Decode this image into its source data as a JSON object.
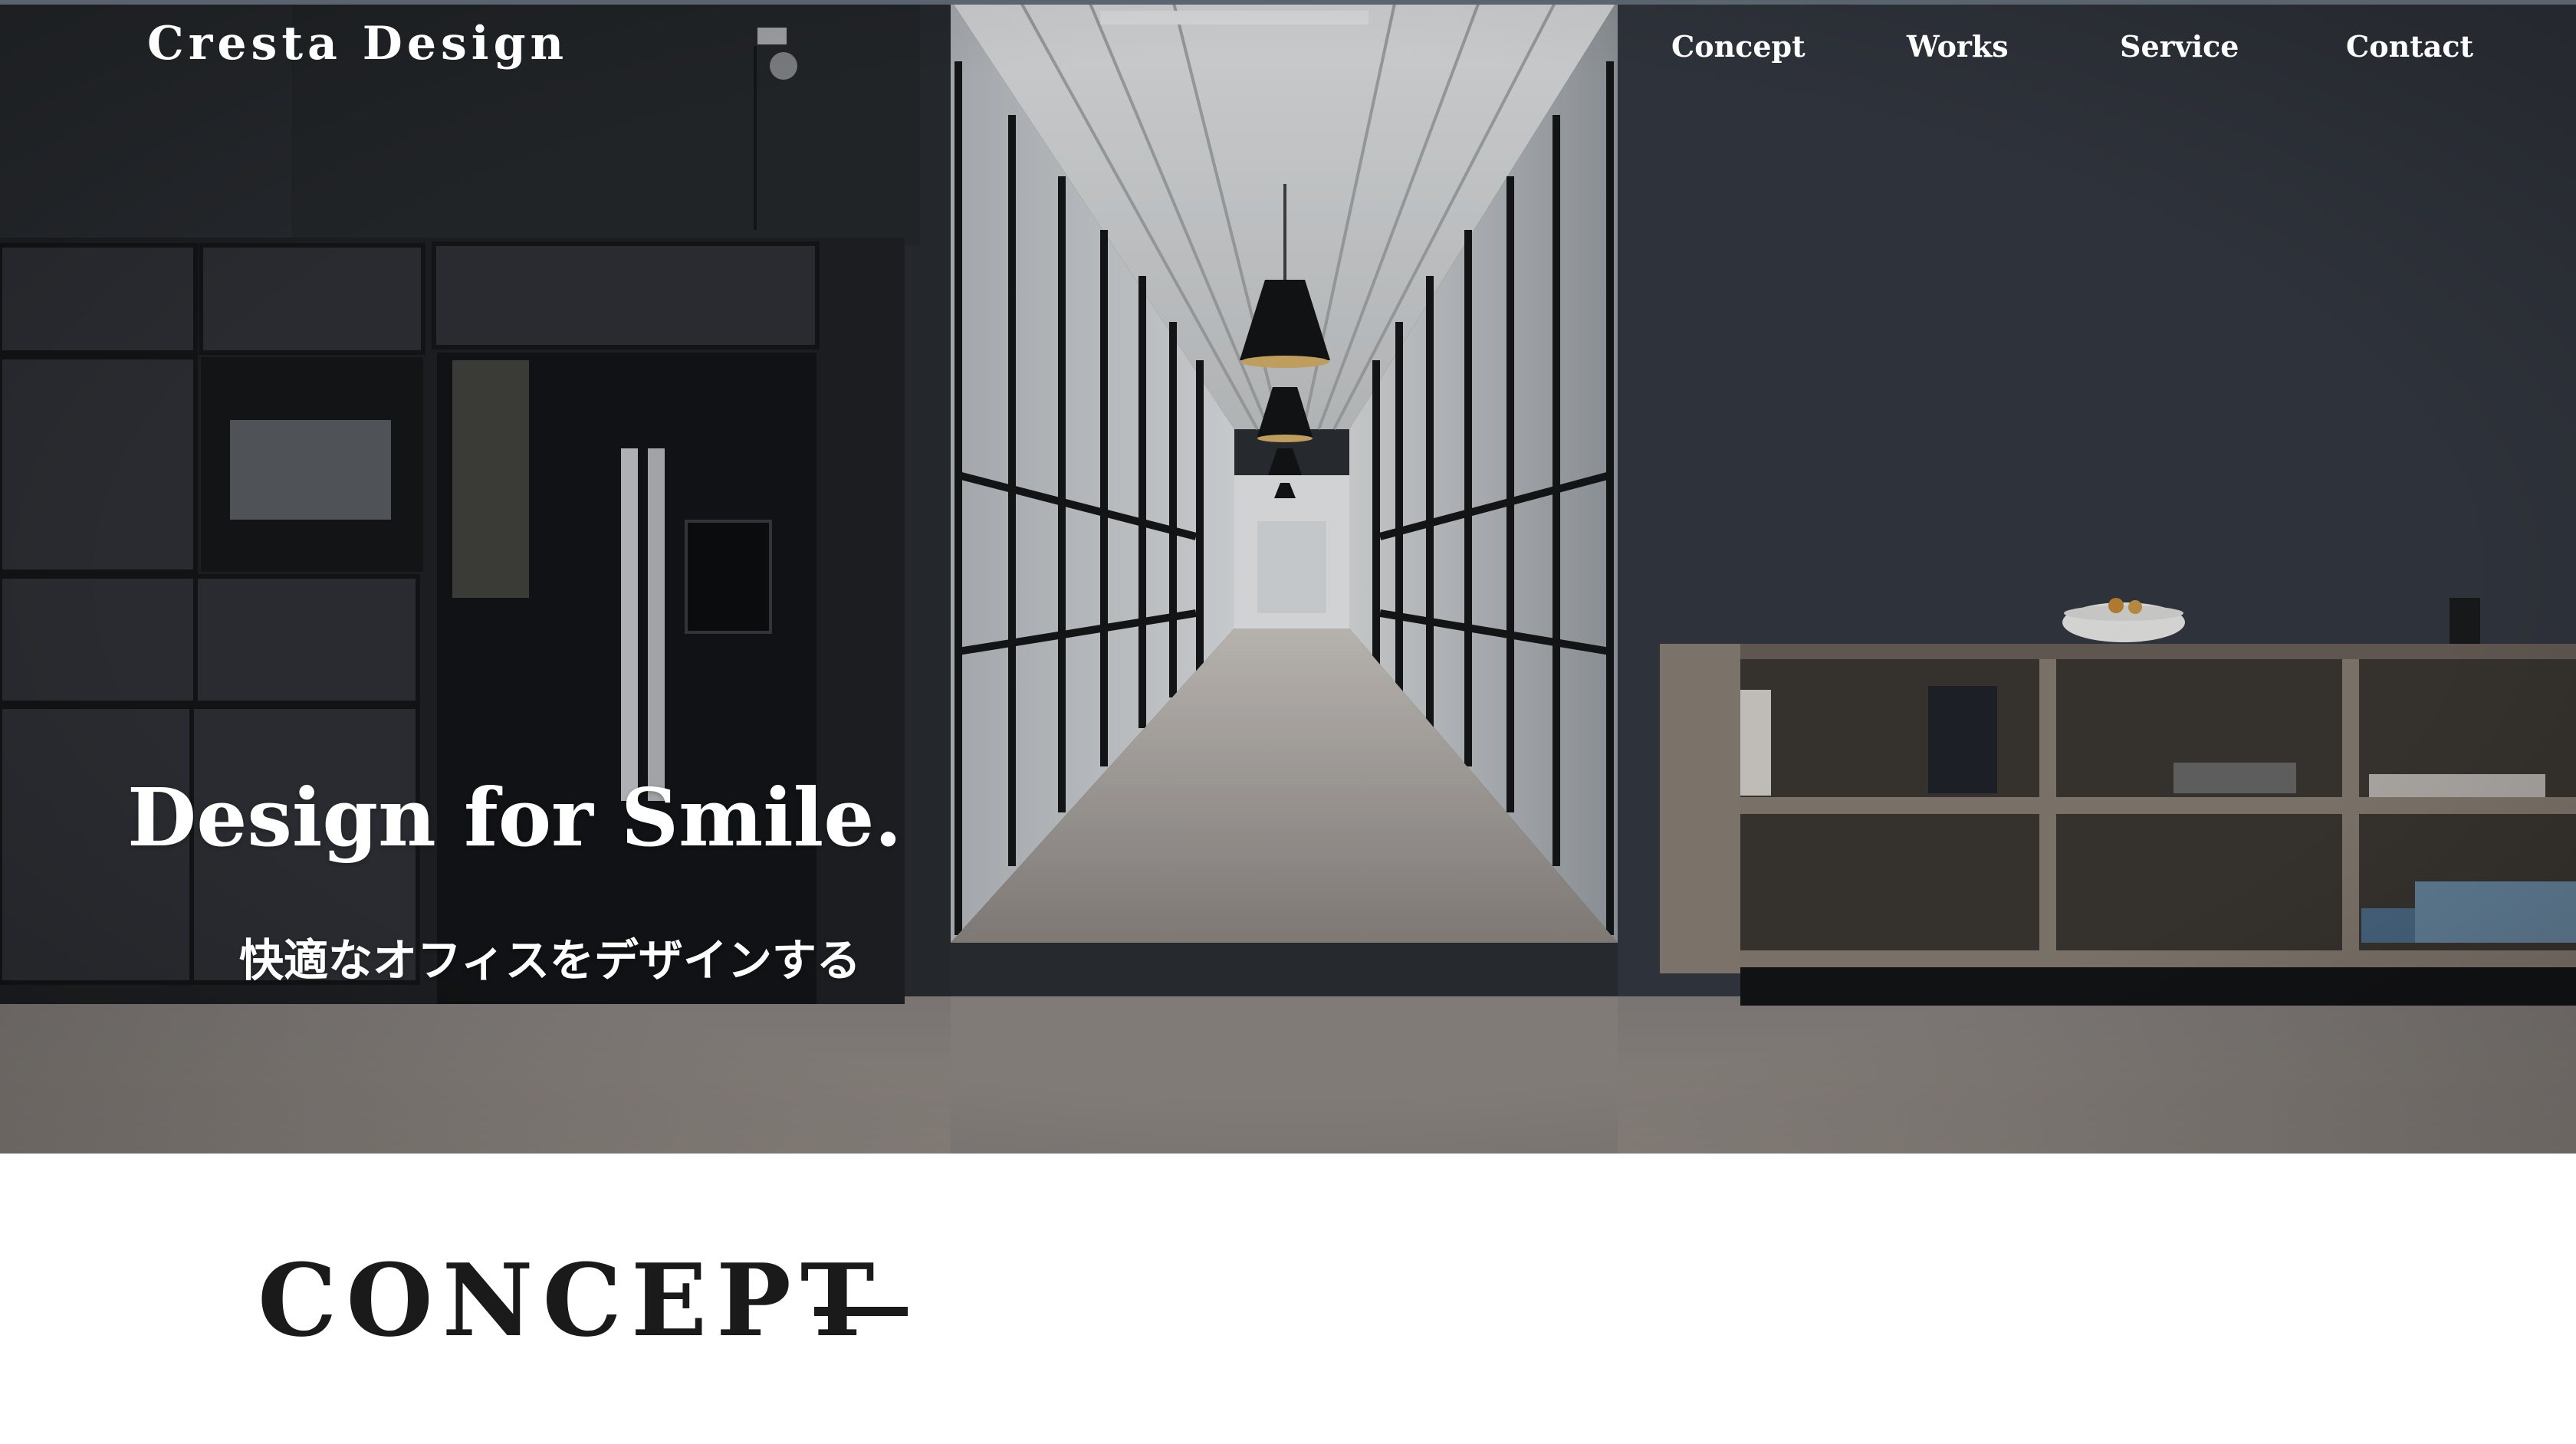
{
  "header": {
    "logo_text": "Cresta Design",
    "nav": [
      {
        "label": "Concept"
      },
      {
        "label": "Works"
      },
      {
        "label": "Service"
      },
      {
        "label": "Contact"
      }
    ]
  },
  "hero": {
    "title": "Design for Smile.",
    "subtitle": "快適なオフィスをデザインする",
    "background_image": "office-corridor-photo"
  },
  "concept": {
    "heading": "CONCEPT"
  },
  "colors": {
    "hero_text": "#ffffff",
    "heading_text": "#1a1a1a",
    "wall_dark": "#2e333a",
    "floor": "#8e8985",
    "page_background": "#ffffff"
  }
}
